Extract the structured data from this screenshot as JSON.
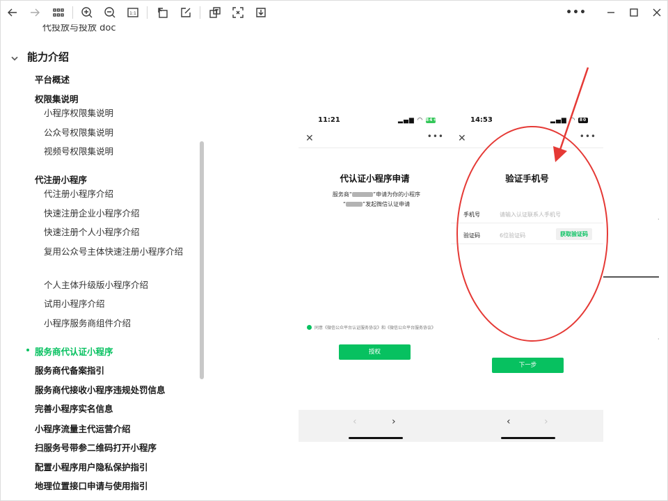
{
  "toolbar": {
    "buttons": [
      "back-icon",
      "forward-icon",
      "grid-view-icon",
      "zoom-in-icon",
      "zoom-out-icon",
      "actual-size-icon",
      "rotate-icon",
      "edit-icon",
      "translate-icon",
      "ocr-icon",
      "download-icon",
      "more-icon",
      "minimize-icon",
      "maximize-icon",
      "close-icon"
    ],
    "actual_size_label": "1:1",
    "more_label": "•••"
  },
  "sidebar": {
    "cut_item": "代投放与投放 doc",
    "section_title": "能力介绍",
    "items": [
      {
        "label": "平台概述",
        "type": "item"
      },
      {
        "label": "权限集说明",
        "type": "item"
      },
      {
        "label": "小程序权限集说明",
        "type": "sub"
      },
      {
        "label": "公众号权限集说明",
        "type": "sub"
      },
      {
        "label": "视频号权限集说明",
        "type": "sub"
      },
      {
        "label": "代注册小程序",
        "type": "item"
      },
      {
        "label": "代注册小程序介绍",
        "type": "sub"
      },
      {
        "label": "快速注册企业小程序介绍",
        "type": "sub"
      },
      {
        "label": "快速注册个人小程序介绍",
        "type": "sub"
      },
      {
        "label": "复用公众号主体快速注册小程序介绍",
        "type": "sub"
      },
      {
        "label": "个人主体升级版小程序介绍",
        "type": "sub"
      },
      {
        "label": "试用小程序介绍",
        "type": "sub"
      },
      {
        "label": "小程序服务商组件介绍",
        "type": "sub"
      },
      {
        "label": "服务商代认证小程序",
        "type": "item",
        "active": true
      },
      {
        "label": "服务商代备案指引",
        "type": "item"
      },
      {
        "label": "服务商代接收小程序违规处罚信息",
        "type": "item"
      },
      {
        "label": "完善小程序实名信息",
        "type": "item"
      },
      {
        "label": "小程序流量主代运营介绍",
        "type": "item"
      },
      {
        "label": "扫服务号带参二维码打开小程序",
        "type": "item"
      },
      {
        "label": "配置小程序用户隐私保护指引",
        "type": "item"
      },
      {
        "label": "地理位置接口申请与使用指引",
        "type": "item"
      }
    ]
  },
  "phone_left": {
    "time": "11:21",
    "battery": "84+",
    "close": "✕",
    "menu": "•••",
    "heading": "代认证小程序申请",
    "desc_line1_a": "服务商“",
    "desc_line1_b": "”申请为你的小程序",
    "desc_line2_a": "“",
    "desc_line2_b": "”发起微信认证申请",
    "agreement": "同意《微信公众平台认证服务协议》和《微信公众平台服务协议》",
    "button": "授权",
    "nav_back": "‹",
    "nav_forward": "›"
  },
  "phone_right": {
    "time": "14:53",
    "battery": "80",
    "close": "✕",
    "menu": "•••",
    "heading": "验证手机号",
    "phone_label": "手机号",
    "phone_placeholder": "请输入认证联系人手机号",
    "code_label": "验证码",
    "code_placeholder": "6位验证码",
    "get_code": "获取验证码",
    "button": "下一步",
    "nav_back": "‹",
    "nav_forward": "›"
  },
  "colors": {
    "accent": "#07c160",
    "annotation": "#e53935"
  }
}
